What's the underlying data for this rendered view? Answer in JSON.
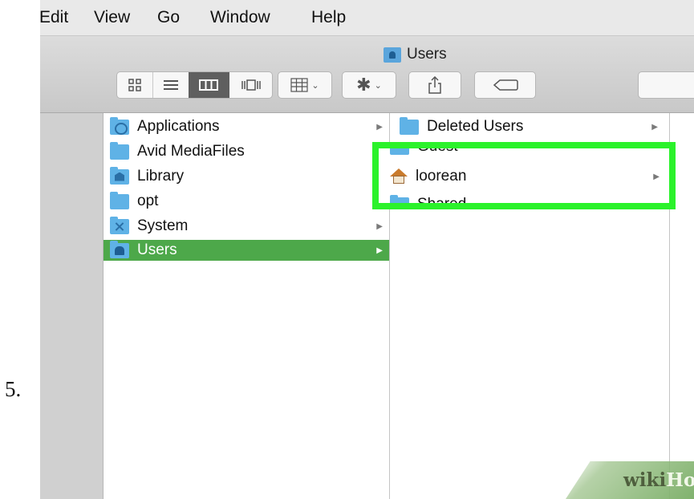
{
  "step_number": "5.",
  "menu": [
    "Edit",
    "View",
    "Go",
    "Window",
    "Help"
  ],
  "window": {
    "title": "Users",
    "title_icon": "users-folder-icon"
  },
  "toolbar": {
    "view_buttons": [
      "icon-view",
      "list-view",
      "column-view",
      "cover-flow-view"
    ],
    "active_view": "column-view",
    "arrange_icon": "arrange-grid-icon",
    "action_icon": "gear-icon",
    "share_icon": "share-icon",
    "tags_icon": "tag-icon"
  },
  "columns": [
    {
      "items": [
        {
          "label": "Applications",
          "icon": "applications-folder-icon",
          "has_children": true,
          "selected": false
        },
        {
          "label": "Avid MediaFiles",
          "icon": "folder-icon",
          "has_children": false,
          "selected": false
        },
        {
          "label": "Library",
          "icon": "library-folder-icon",
          "has_children": false,
          "selected": false
        },
        {
          "label": "opt",
          "icon": "folder-icon",
          "has_children": false,
          "selected": false
        },
        {
          "label": "System",
          "icon": "system-folder-icon",
          "has_children": true,
          "selected": false
        },
        {
          "label": "Users",
          "icon": "users-folder-icon",
          "has_children": true,
          "selected": true
        }
      ]
    },
    {
      "items": [
        {
          "label": "Deleted Users",
          "icon": "folder-icon",
          "has_children": true,
          "selected": false
        },
        {
          "label": "Guest",
          "icon": "folder-icon",
          "has_children": true,
          "selected": false
        },
        {
          "label": "loorean",
          "icon": "home-icon",
          "has_children": true,
          "selected": false
        },
        {
          "label": "Shared",
          "icon": "folder-icon",
          "has_children": true,
          "selected": false
        }
      ]
    }
  ],
  "highlight_color": "#2bf22b",
  "selection_color": "#4da84a",
  "watermark": {
    "part1": "wiki",
    "part2": "How"
  }
}
